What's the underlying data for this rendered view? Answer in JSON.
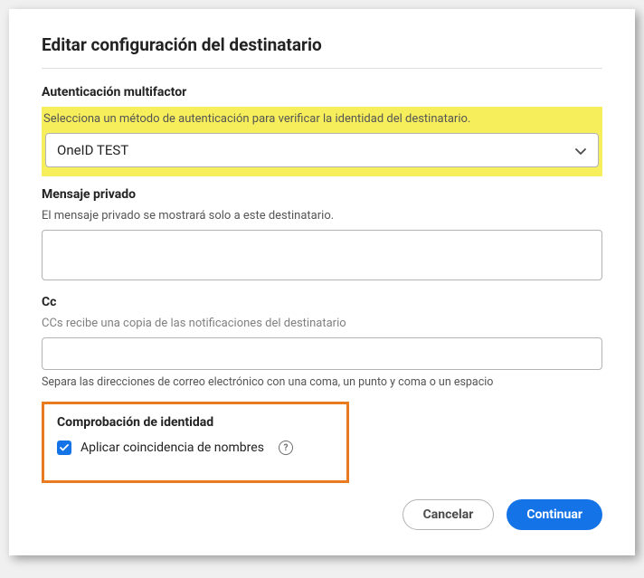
{
  "dialog": {
    "title": "Editar configuración del destinatario"
  },
  "mfa": {
    "label": "Autenticación multifactor",
    "hint": "Selecciona un método de autenticación para verificar la identidad del destinatario.",
    "selected": "OneID TEST"
  },
  "privateMsg": {
    "label": "Mensaje privado",
    "hint": "El mensaje privado se mostrará solo a este destinatario.",
    "value": ""
  },
  "cc": {
    "label": "Cc",
    "hint": "CCs recibe una copia de las notificaciones del destinatario",
    "value": "",
    "belowHint": "Separa las direcciones de correo electrónico con una coma, un punto y coma o un espacio"
  },
  "identity": {
    "label": "Comprobación de identidad",
    "checkbox": {
      "checked": true,
      "label": "Aplicar coincidencia de nombres"
    }
  },
  "buttons": {
    "cancel": "Cancelar",
    "continue": "Continuar"
  }
}
